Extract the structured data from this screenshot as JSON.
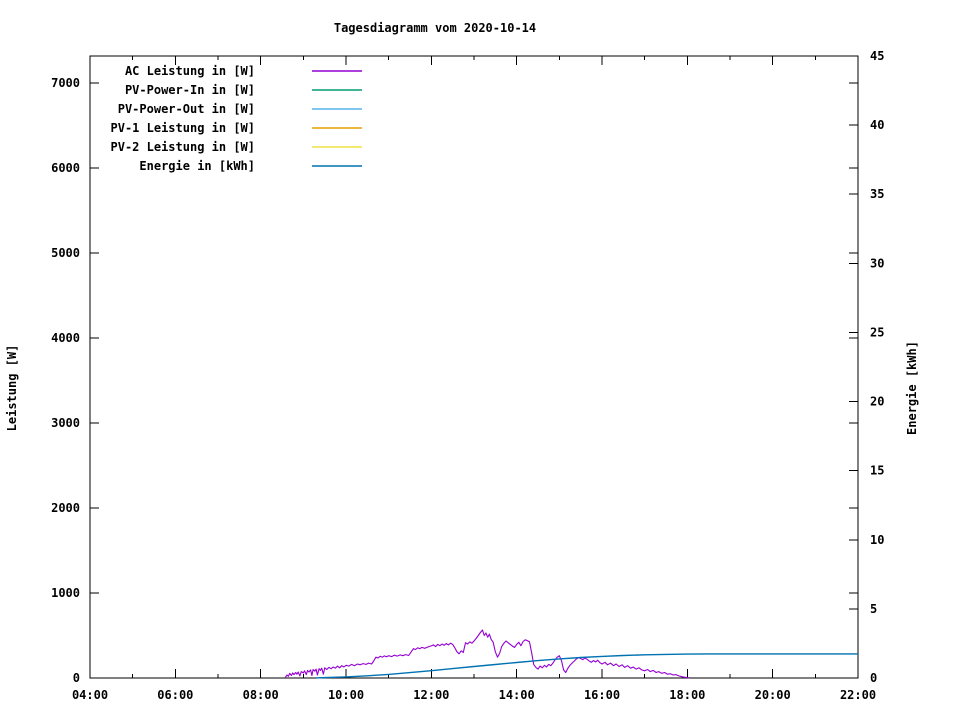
{
  "chart_data": {
    "type": "line",
    "title": "Tagesdiagramm vom 2020-10-14",
    "grid": false,
    "legend_position": "top-left-inside",
    "x_axis": {
      "unit": "time",
      "start_hour": 4,
      "end_hour": 22,
      "minor_step_hours": 1,
      "major_step_hours": 2,
      "major_tick_labels": [
        "04:00",
        "06:00",
        "08:00",
        "10:00",
        "12:00",
        "14:00",
        "16:00",
        "18:00",
        "20:00",
        "22:00"
      ]
    },
    "y_left": {
      "label": "Leistung [W]",
      "range_max": 7318,
      "ticks": [
        0,
        1000,
        2000,
        3000,
        4000,
        5000,
        6000,
        7000
      ],
      "tick_labels": [
        "0",
        "1000",
        "2000",
        "3000",
        "4000",
        "5000",
        "6000",
        "7000"
      ]
    },
    "y_right": {
      "label": "Energie [kWh]",
      "range_max": 45,
      "ticks": [
        0,
        5,
        10,
        15,
        20,
        25,
        30,
        35,
        40,
        45
      ],
      "tick_labels": [
        "0",
        "5",
        "10",
        "15",
        "20",
        "25",
        "30",
        "35",
        "40",
        "45"
      ]
    },
    "series": [
      {
        "name": "AC Leistung in [W]",
        "color": "#9400d3",
        "axis": "left",
        "points": [
          [
            8.58,
            8
          ],
          [
            8.62,
            35
          ],
          [
            8.65,
            20
          ],
          [
            8.68,
            55
          ],
          [
            8.72,
            30
          ],
          [
            8.75,
            60
          ],
          [
            8.78,
            40
          ],
          [
            8.82,
            65
          ],
          [
            8.85,
            45
          ],
          [
            8.88,
            70
          ],
          [
            8.92,
            25
          ],
          [
            8.95,
            75
          ],
          [
            9.0,
            60
          ],
          [
            9.03,
            85
          ],
          [
            9.07,
            40
          ],
          [
            9.1,
            90
          ],
          [
            9.13,
            70
          ],
          [
            9.17,
            95
          ],
          [
            9.2,
            30
          ],
          [
            9.23,
            100
          ],
          [
            9.27,
            80
          ],
          [
            9.3,
            105
          ],
          [
            9.33,
            35
          ],
          [
            9.37,
            110
          ],
          [
            9.4,
            90
          ],
          [
            9.43,
            115
          ],
          [
            9.47,
            45
          ],
          [
            9.5,
            120
          ],
          [
            9.55,
            100
          ],
          [
            9.6,
            125
          ],
          [
            9.65,
            110
          ],
          [
            9.7,
            130
          ],
          [
            9.75,
            115
          ],
          [
            9.8,
            140
          ],
          [
            9.85,
            120
          ],
          [
            9.9,
            145
          ],
          [
            9.95,
            130
          ],
          [
            10.0,
            150
          ],
          [
            10.07,
            140
          ],
          [
            10.13,
            160
          ],
          [
            10.2,
            145
          ],
          [
            10.27,
            165
          ],
          [
            10.33,
            155
          ],
          [
            10.4,
            170
          ],
          [
            10.47,
            160
          ],
          [
            10.53,
            175
          ],
          [
            10.6,
            165
          ],
          [
            10.65,
            200
          ],
          [
            10.7,
            245
          ],
          [
            10.75,
            235
          ],
          [
            10.8,
            255
          ],
          [
            10.85,
            245
          ],
          [
            10.9,
            260
          ],
          [
            10.95,
            250
          ],
          [
            11.0,
            262
          ],
          [
            11.07,
            252
          ],
          [
            11.13,
            268
          ],
          [
            11.2,
            258
          ],
          [
            11.27,
            272
          ],
          [
            11.33,
            262
          ],
          [
            11.4,
            275
          ],
          [
            11.47,
            265
          ],
          [
            11.53,
            310
          ],
          [
            11.58,
            345
          ],
          [
            11.63,
            335
          ],
          [
            11.68,
            355
          ],
          [
            11.73,
            345
          ],
          [
            11.78,
            360
          ],
          [
            11.85,
            350
          ],
          [
            11.92,
            365
          ],
          [
            12.0,
            378
          ],
          [
            12.05,
            390
          ],
          [
            12.1,
            370
          ],
          [
            12.15,
            395
          ],
          [
            12.2,
            380
          ],
          [
            12.25,
            400
          ],
          [
            12.3,
            385
          ],
          [
            12.35,
            405
          ],
          [
            12.4,
            390
          ],
          [
            12.45,
            410
          ],
          [
            12.5,
            395
          ],
          [
            12.55,
            355
          ],
          [
            12.6,
            310
          ],
          [
            12.65,
            285
          ],
          [
            12.7,
            320
          ],
          [
            12.75,
            300
          ],
          [
            12.8,
            415
          ],
          [
            12.85,
            400
          ],
          [
            12.9,
            425
          ],
          [
            12.95,
            410
          ],
          [
            13.0,
            435
          ],
          [
            13.05,
            465
          ],
          [
            13.1,
            500
          ],
          [
            13.15,
            535
          ],
          [
            13.2,
            565
          ],
          [
            13.24,
            500
          ],
          [
            13.28,
            530
          ],
          [
            13.32,
            480
          ],
          [
            13.36,
            515
          ],
          [
            13.4,
            455
          ],
          [
            13.45,
            420
          ],
          [
            13.5,
            310
          ],
          [
            13.55,
            245
          ],
          [
            13.6,
            290
          ],
          [
            13.65,
            370
          ],
          [
            13.7,
            410
          ],
          [
            13.75,
            435
          ],
          [
            13.8,
            415
          ],
          [
            13.85,
            395
          ],
          [
            13.9,
            375
          ],
          [
            13.95,
            360
          ],
          [
            14.0,
            395
          ],
          [
            14.05,
            420
          ],
          [
            14.1,
            380
          ],
          [
            14.15,
            430
          ],
          [
            14.2,
            450
          ],
          [
            14.25,
            440
          ],
          [
            14.3,
            425
          ],
          [
            14.35,
            300
          ],
          [
            14.4,
            160
          ],
          [
            14.45,
            125
          ],
          [
            14.5,
            105
          ],
          [
            14.55,
            140
          ],
          [
            14.6,
            120
          ],
          [
            14.65,
            150
          ],
          [
            14.7,
            130
          ],
          [
            14.75,
            160
          ],
          [
            14.8,
            145
          ],
          [
            14.85,
            175
          ],
          [
            14.9,
            215
          ],
          [
            14.95,
            245
          ],
          [
            15.0,
            262
          ],
          [
            15.05,
            205
          ],
          [
            15.1,
            95
          ],
          [
            15.15,
            65
          ],
          [
            15.2,
            115
          ],
          [
            15.25,
            150
          ],
          [
            15.3,
            175
          ],
          [
            15.35,
            200
          ],
          [
            15.4,
            225
          ],
          [
            15.45,
            240
          ],
          [
            15.5,
            230
          ],
          [
            15.55,
            215
          ],
          [
            15.6,
            235
          ],
          [
            15.65,
            220
          ],
          [
            15.7,
            200
          ],
          [
            15.75,
            185
          ],
          [
            15.8,
            205
          ],
          [
            15.85,
            190
          ],
          [
            15.9,
            210
          ],
          [
            15.95,
            180
          ],
          [
            16.0,
            165
          ],
          [
            16.07,
            185
          ],
          [
            16.13,
            155
          ],
          [
            16.2,
            175
          ],
          [
            16.27,
            145
          ],
          [
            16.33,
            165
          ],
          [
            16.4,
            135
          ],
          [
            16.47,
            155
          ],
          [
            16.53,
            125
          ],
          [
            16.6,
            145
          ],
          [
            16.67,
            115
          ],
          [
            16.73,
            130
          ],
          [
            16.8,
            105
          ],
          [
            16.87,
            120
          ],
          [
            16.93,
            95
          ],
          [
            17.0,
            85
          ],
          [
            17.07,
            100
          ],
          [
            17.13,
            75
          ],
          [
            17.2,
            90
          ],
          [
            17.27,
            65
          ],
          [
            17.33,
            75
          ],
          [
            17.4,
            55
          ],
          [
            17.47,
            65
          ],
          [
            17.53,
            45
          ],
          [
            17.6,
            50
          ],
          [
            17.67,
            35
          ],
          [
            17.73,
            40
          ],
          [
            17.8,
            25
          ],
          [
            17.87,
            15
          ],
          [
            17.93,
            10
          ],
          [
            18.0,
            5
          ],
          [
            18.05,
            2
          ]
        ]
      },
      {
        "name": "PV-Power-In in [W]",
        "color": "#009e73",
        "axis": "left",
        "points": []
      },
      {
        "name": "PV-Power-Out in [W]",
        "color": "#56b4e9",
        "axis": "left",
        "points": []
      },
      {
        "name": "PV-1 Leistung in [W]",
        "color": "#e69f00",
        "axis": "left",
        "points": []
      },
      {
        "name": "PV-2 Leistung in [W]",
        "color": "#f0e442",
        "axis": "left",
        "points": []
      },
      {
        "name": "Energie in [kWh]",
        "color": "#0072b2",
        "axis": "right",
        "points": [
          [
            9.3,
            0.01
          ],
          [
            9.5,
            0.03
          ],
          [
            10.0,
            0.08
          ],
          [
            10.5,
            0.16
          ],
          [
            11.0,
            0.26
          ],
          [
            11.5,
            0.39
          ],
          [
            12.0,
            0.53
          ],
          [
            12.5,
            0.68
          ],
          [
            13.0,
            0.83
          ],
          [
            13.5,
            0.98
          ],
          [
            14.0,
            1.12
          ],
          [
            14.5,
            1.26
          ],
          [
            15.0,
            1.38
          ],
          [
            15.5,
            1.48
          ],
          [
            16.0,
            1.56
          ],
          [
            16.5,
            1.63
          ],
          [
            17.0,
            1.68
          ],
          [
            17.5,
            1.71
          ],
          [
            18.0,
            1.73
          ],
          [
            18.5,
            1.74
          ],
          [
            19.0,
            1.74
          ],
          [
            20.0,
            1.74
          ],
          [
            21.0,
            1.74
          ],
          [
            22.0,
            1.74
          ]
        ]
      }
    ]
  }
}
